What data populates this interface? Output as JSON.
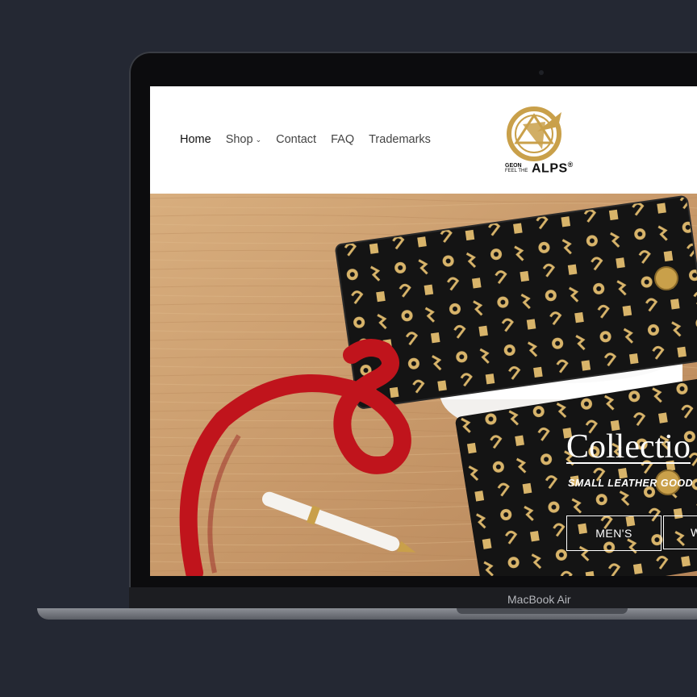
{
  "laptop": {
    "model_label": "MacBook Air"
  },
  "nav": {
    "items": [
      {
        "label": "Home",
        "active": true
      },
      {
        "label": "Shop",
        "has_dropdown": true
      },
      {
        "label": "Contact"
      },
      {
        "label": "FAQ"
      },
      {
        "label": "Trademarks"
      }
    ],
    "dropdown_icon": "chevron-down-icon"
  },
  "logo": {
    "line1": "GEON",
    "line2": "FEEL THE",
    "brand": "ALPS",
    "mark": "®"
  },
  "hero": {
    "title": "Collectio",
    "subtitle": "SMALL LEATHER GOOD",
    "buttons": {
      "men": "MEN'S",
      "women": "W"
    }
  },
  "colors": {
    "page_bg": "#242833",
    "gold": "#c9a04a",
    "wallet": "#141414",
    "ribbon": "#c0141c",
    "wood": "#c79a6a"
  }
}
